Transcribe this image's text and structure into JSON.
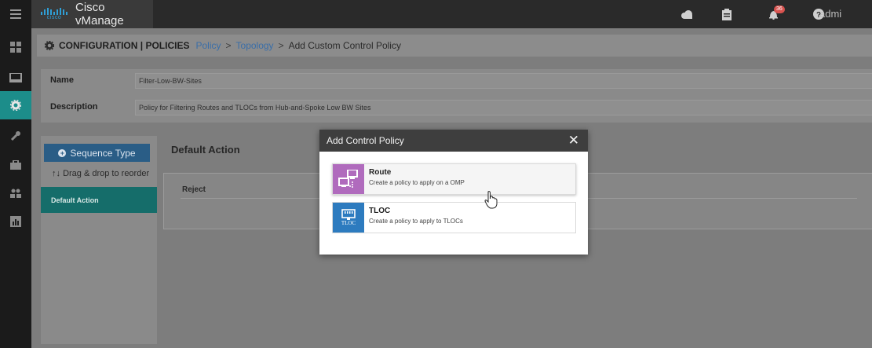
{
  "app": {
    "title": "Cisco vManage",
    "logo_word": "cisco",
    "user": "admi"
  },
  "rail": {
    "items": [
      "menu-icon",
      "dashboard-icon",
      "monitor-icon",
      "configuration-icon",
      "tools-icon",
      "maintenance-icon",
      "administration-icon",
      "analytics-icon"
    ]
  },
  "topbar": {
    "icons": [
      "cloud-icon",
      "task-list-icon",
      "alarm-bell-icon",
      "help-icon"
    ],
    "alarm_count": "36"
  },
  "breadcrumb": {
    "title": "CONFIGURATION | POLICIES",
    "items": [
      "Policy",
      "Topology"
    ],
    "separator": ">",
    "current": "Add Custom Control Policy"
  },
  "form": {
    "name_label": "Name",
    "name_value": "Filter-Low-BW-Sites",
    "description_label": "Description",
    "description_value": "Policy for Filtering Routes and TLOCs from Hub-and-Spoke Low BW Sites"
  },
  "sequence": {
    "button_label": "Sequence Type",
    "drag_hint": "Drag & drop to reorder",
    "default_action_item": "Default Action"
  },
  "main": {
    "title": "Default Action",
    "reject_label": "Reject"
  },
  "modal": {
    "title": "Add Control Policy",
    "close": "✕",
    "options": [
      {
        "title": "Route",
        "description": "Create a policy to apply on a OMP",
        "icon": "route-icon",
        "color": "#b06bbd"
      },
      {
        "title": "TLOC",
        "description": "Create a policy to apply to TLOCs",
        "icon": "tloc-icon",
        "color": "#2d7bbf",
        "icon_text": "TLOC"
      }
    ]
  },
  "colors": {
    "accent": "#1c8d8a",
    "link": "#3a6ea8",
    "button": "#2a5d86"
  }
}
